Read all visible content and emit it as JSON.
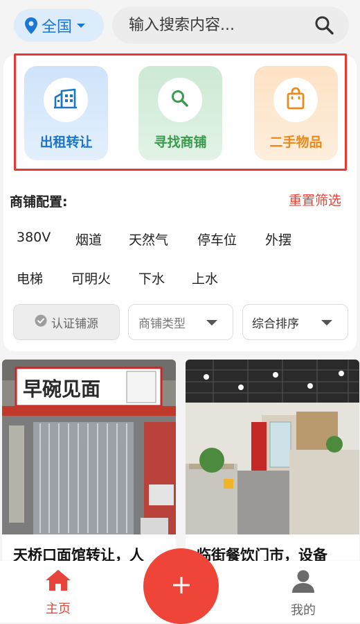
{
  "header": {
    "region_label": "全国",
    "search_placeholder": "输入搜索内容..."
  },
  "categories": [
    {
      "label": "出租转让",
      "icon": "building-icon",
      "color": "#1a75c9"
    },
    {
      "label": "寻找商铺",
      "icon": "search-icon",
      "color": "#3c9a4e"
    },
    {
      "label": "二手物品",
      "icon": "shopping-bag-icon",
      "color": "#e88b1e"
    }
  ],
  "config": {
    "title": "商铺配置:",
    "reset_label": "重置筛选",
    "tags_row1": [
      "380V",
      "烟道",
      "天然气",
      "停车位",
      "外摆"
    ],
    "tags_row2": [
      "电梯",
      "可明火",
      "下水",
      "上水"
    ]
  },
  "filters": {
    "verified_label": "认证铺源",
    "type_label": "商铺类型",
    "sort_label": "综合排序"
  },
  "listings": [
    {
      "title": "天桥口面馆转让，人",
      "sign_text": "早碗见面"
    },
    {
      "title": "临街餐饮门市，设备"
    }
  ],
  "bottom_nav": {
    "home_label": "主页",
    "mine_label": "我的",
    "active_color": "#e5453a",
    "fab_color": "#ef4438"
  }
}
